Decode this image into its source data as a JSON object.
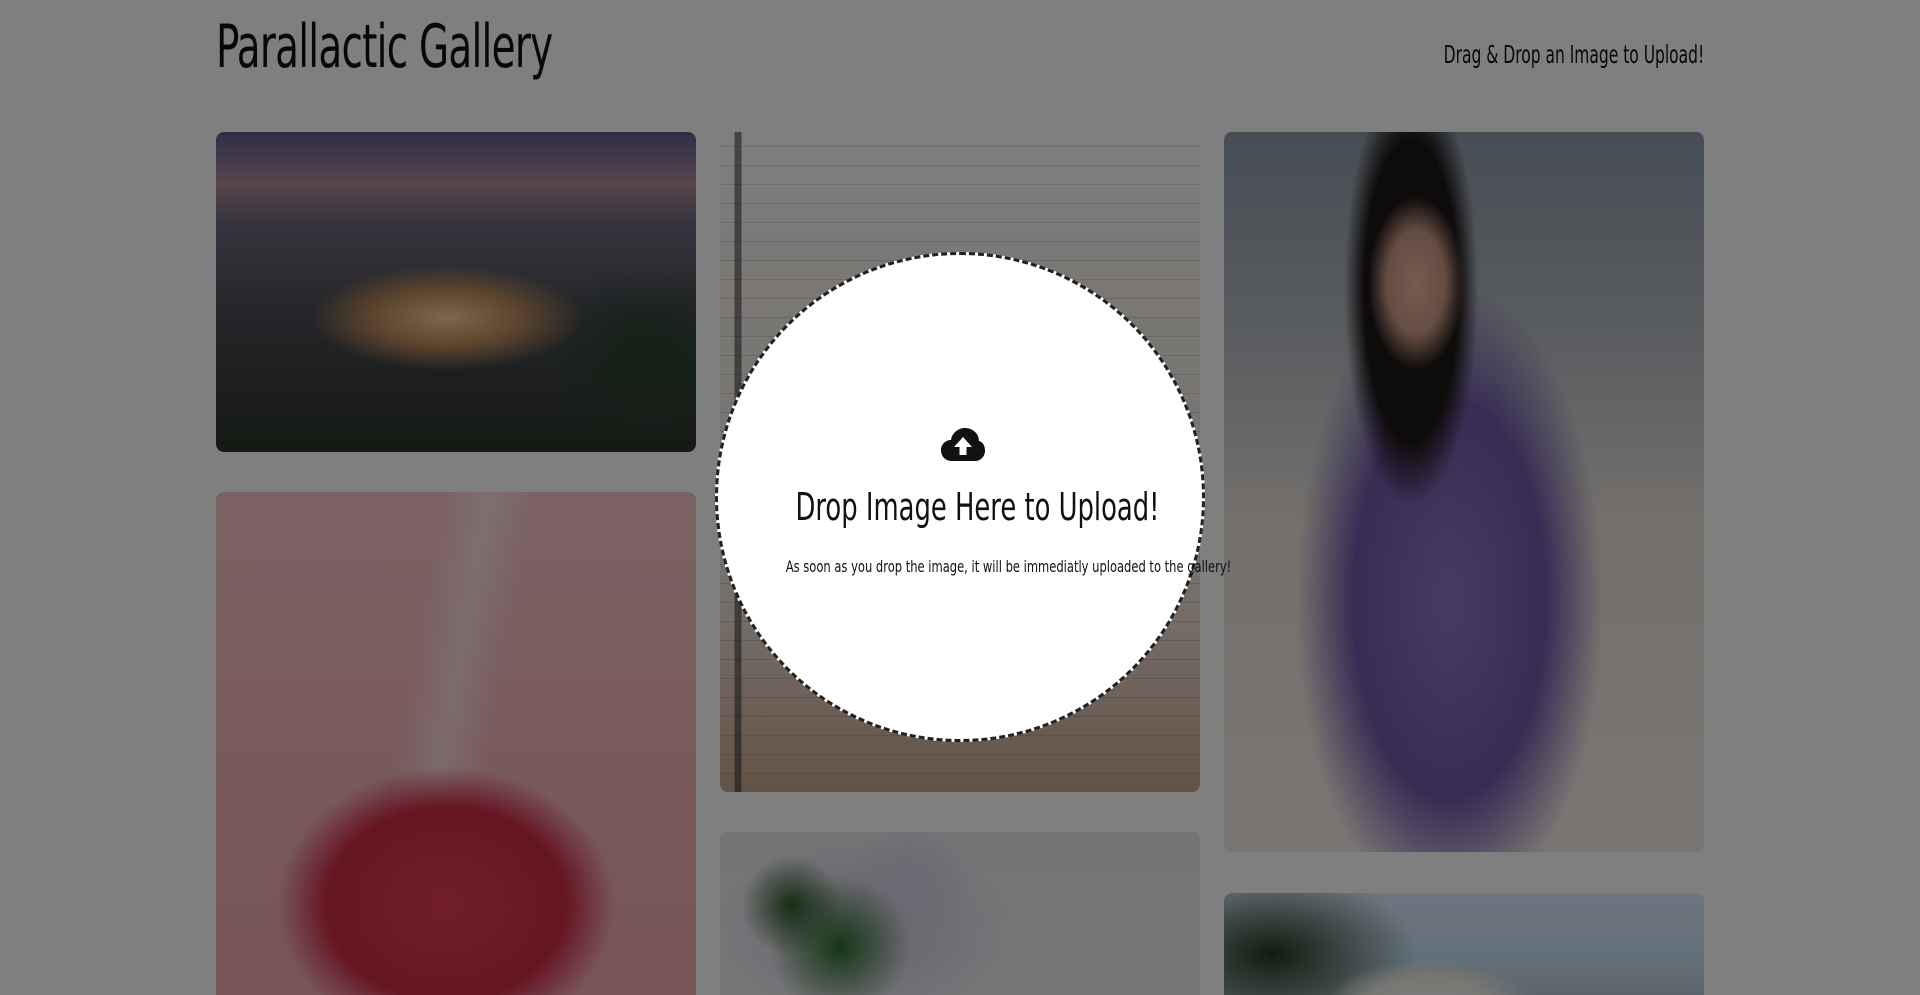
{
  "header": {
    "title": "Parallactic Gallery",
    "hint": "Drag & Drop an Image to Upload!"
  },
  "gallery": {
    "cards": [
      {
        "label": "city-night-square"
      },
      {
        "label": "interior-room"
      },
      {
        "label": "woman-purple-suit"
      },
      {
        "label": "lip-mask-splash"
      },
      {
        "label": "lilac-basket"
      },
      {
        "label": "flower-garden"
      }
    ]
  },
  "dropzone": {
    "icon": "cloud-upload-icon",
    "title": "Drop Image Here to Upload!",
    "subtitle": "As soon as you drop the image, it will be immediatly uploaded to the gallery!"
  },
  "colors": {
    "overlay": "#000000",
    "dropzone_bg": "#ffffff",
    "text": "#111111"
  }
}
